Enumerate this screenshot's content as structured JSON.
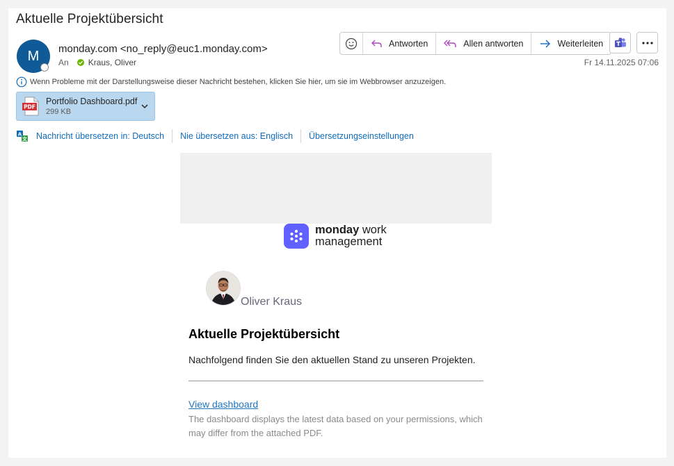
{
  "mail": {
    "subject": "Aktuelle Projektübersicht",
    "avatar_initial": "M",
    "sender": "monday.com <no_reply@euc1.monday.com>",
    "to_label": "An",
    "recipient": "Kraus, Oliver",
    "date": "Fr 14.11.2025 07:06",
    "info_text": "Wenn Probleme mit der Darstellungsweise dieser Nachricht bestehen, klicken Sie hier, um sie im Webbrowser anzuzeigen."
  },
  "toolbar": {
    "reply": "Antworten",
    "reply_all": "Allen antworten",
    "forward": "Weiterleiten"
  },
  "attachment": {
    "name": "Portfolio Dashboard.pdf",
    "size": "299 KB",
    "badge": "PDF"
  },
  "translation": {
    "translate": "Nachricht übersetzen in: Deutsch",
    "never_translate": "Nie übersetzen aus: Englisch",
    "settings": "Übersetzungseinstellungen"
  },
  "email_body": {
    "brand_bold": "monday",
    "brand_rest1": "work",
    "brand_rest2": "management",
    "person_name": "Oliver Kraus",
    "title": "Aktuelle Projektübersicht",
    "text": "Nachfolgend finden Sie den aktuellen Stand zu unseren Projekten.",
    "link": "View dashboard",
    "disclaimer": "The dashboard displays the latest data based on your permissions, which may differ from the attached PDF."
  },
  "colors": {
    "accent": "#0f6cbd",
    "avatar": "#0f5a97",
    "brand": "#6161ff",
    "attachment_bg": "#b9d8f0"
  }
}
